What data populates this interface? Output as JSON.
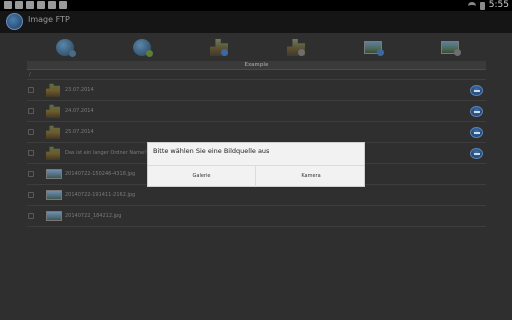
{
  "status_bar": {
    "time": "5:55"
  },
  "action_bar": {
    "title": "Image FTP"
  },
  "list": {
    "header": "Example",
    "path": "/",
    "rows": [
      {
        "type": "folder",
        "label": "23.07.2014"
      },
      {
        "type": "folder",
        "label": "24.07.2014"
      },
      {
        "type": "folder",
        "label": "25.07.2014"
      },
      {
        "type": "folder",
        "label": "Das ist ein langer Ordner Name!!!"
      },
      {
        "type": "image",
        "label": "20140722-150246-4318.jpg"
      },
      {
        "type": "image",
        "label": "20140722-191411-2162.jpg"
      },
      {
        "type": "image",
        "label": "20140722_184212.jpg"
      }
    ]
  },
  "dialog": {
    "title": "Bitte wählen Sie eine Bildquelle aus",
    "gallery_label": "Galerie",
    "camera_label": "Kamera"
  }
}
